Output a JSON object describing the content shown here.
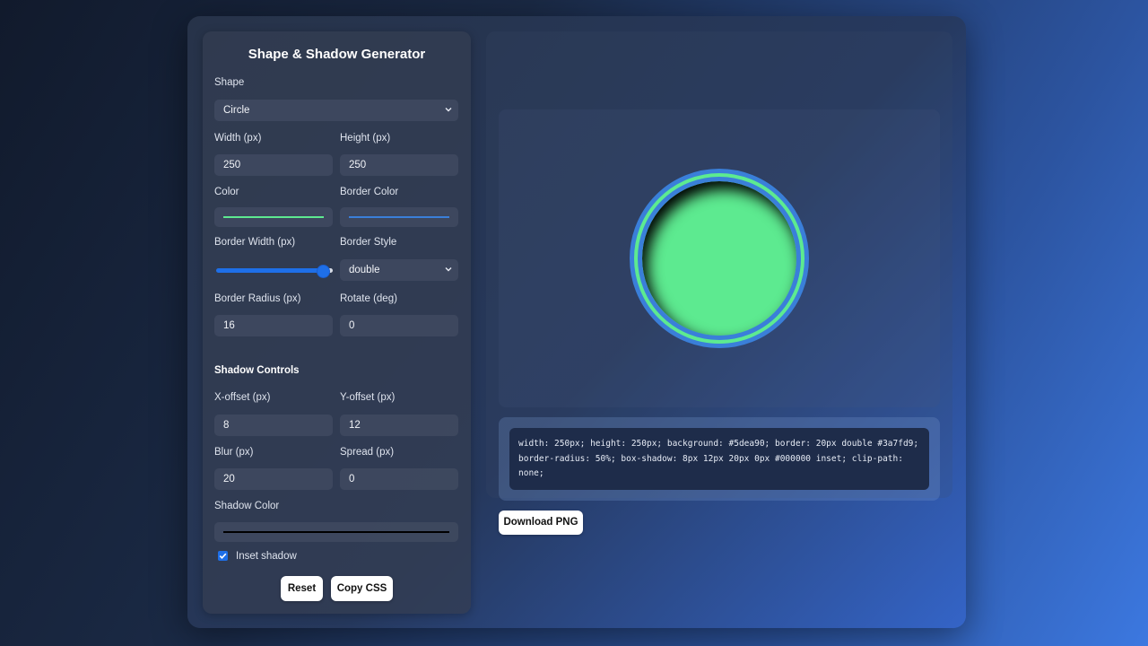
{
  "panel": {
    "title": "Shape & Shadow Generator",
    "shape_label": "Shape",
    "shape_value": "Circle",
    "width_label": "Width (px)",
    "width_value": "250",
    "height_label": "Height (px)",
    "height_value": "250",
    "color_label": "Color",
    "color_value": "#5dea90",
    "border_color_label": "Border Color",
    "border_color_value": "#3a7fd9",
    "border_width_label": "Border Width (px)",
    "border_width_fraction": 0.93,
    "border_style_label": "Border Style",
    "border_style_value": "double",
    "border_radius_label": "Border Radius (px)",
    "border_radius_value": "16",
    "rotate_label": "Rotate (deg)",
    "rotate_value": "0",
    "shadow_section_title": "Shadow Controls",
    "x_offset_label": "X-offset (px)",
    "x_offset_value": "8",
    "y_offset_label": "Y-offset (px)",
    "y_offset_value": "12",
    "blur_label": "Blur (px)",
    "blur_value": "20",
    "spread_label": "Spread (px)",
    "spread_value": "0",
    "shadow_color_label": "Shadow Color",
    "shadow_color_value": "#000000",
    "inset_label": "Inset shadow",
    "inset_checked": true,
    "reset_label": "Reset",
    "copy_label": "Copy CSS"
  },
  "preview": {
    "shape_color": "#5dea90",
    "border_color": "#3a7fd9",
    "css_code": "width: 250px; height: 250px; background: #5dea90; border: 20px double #3a7fd9; border-radius: 50%; box-shadow: 8px 12px 20px 0px #000000 inset; clip-path: none;",
    "download_label": "Download PNG"
  },
  "colors": {
    "accent": "#1e6fe8",
    "panel_bg": "#343e52",
    "code_bg": "#1e2c4a"
  }
}
